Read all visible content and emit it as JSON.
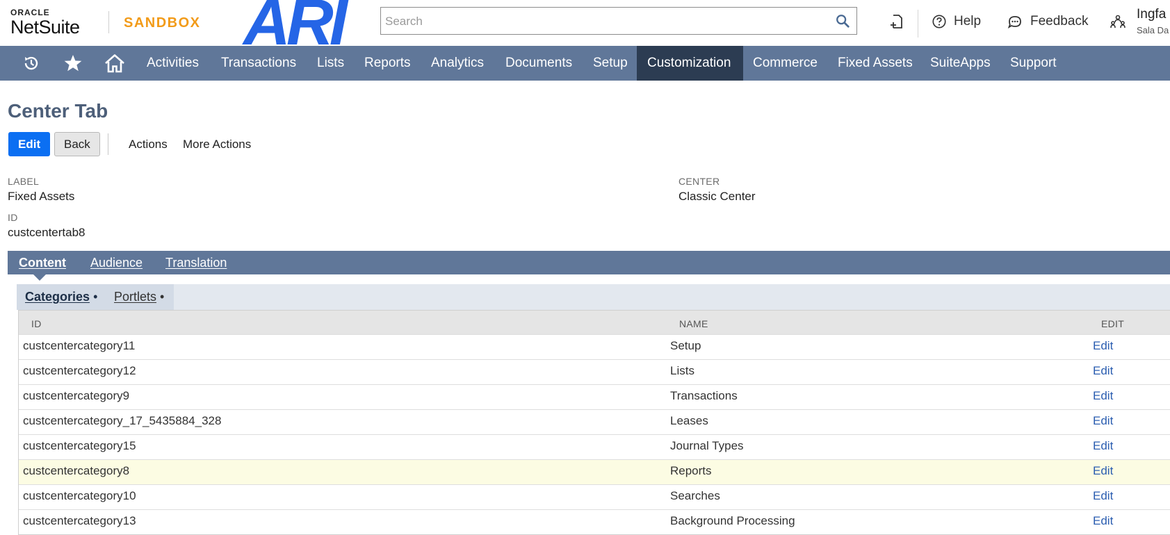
{
  "header": {
    "logo_oracle": "ORACLE",
    "logo_netsuite": "NetSuite",
    "environment": "SANDBOX",
    "company_logo": "ARI",
    "search_placeholder": "Search",
    "help_label": "Help",
    "feedback_label": "Feedback",
    "user_name": "Ingfa",
    "user_role": "Sala Da"
  },
  "icons": {
    "search": "search-icon",
    "new_record": "new-record-icon",
    "help": "help-icon",
    "feedback": "feedback-icon",
    "user_roles": "user-roles-icon",
    "recent": "recent-records-icon",
    "shortcuts": "shortcuts-star-icon",
    "home": "home-icon"
  },
  "nav": {
    "items": [
      "Activities",
      "Transactions",
      "Lists",
      "Reports",
      "Analytics",
      "Documents",
      "Setup",
      "Customization",
      "Commerce",
      "Fixed Assets",
      "SuiteApps",
      "Support"
    ],
    "active": "Customization"
  },
  "page": {
    "title": "Center Tab",
    "edit_button": "Edit",
    "back_button": "Back",
    "actions_label": "Actions",
    "more_actions_label": "More Actions"
  },
  "fields": {
    "label_caption": "LABEL",
    "label_value": "Fixed Assets",
    "center_caption": "CENTER",
    "center_value": "Classic Center",
    "id_caption": "ID",
    "id_value": "custcentertab8"
  },
  "tabs": [
    "Content",
    "Audience",
    "Translation"
  ],
  "active_tab": "Content",
  "subtabs": [
    "Categories",
    "Portlets"
  ],
  "active_subtab": "Categories",
  "subtab_marker": "•",
  "table": {
    "columns": [
      "ID",
      "NAME",
      "EDIT"
    ],
    "rows": [
      {
        "id": "custcentercategory11",
        "name": "Setup",
        "edit": "Edit"
      },
      {
        "id": "custcentercategory12",
        "name": "Lists",
        "edit": "Edit"
      },
      {
        "id": "custcentercategory9",
        "name": "Transactions",
        "edit": "Edit"
      },
      {
        "id": "custcentercategory_17_5435884_328",
        "name": "Leases",
        "edit": "Edit"
      },
      {
        "id": "custcentercategory15",
        "name": "Journal Types",
        "edit": "Edit"
      },
      {
        "id": "custcentercategory8",
        "name": "Reports",
        "edit": "Edit"
      },
      {
        "id": "custcentercategory10",
        "name": "Searches",
        "edit": "Edit"
      },
      {
        "id": "custcentercategory13",
        "name": "Background Processing",
        "edit": "Edit"
      }
    ],
    "highlighted_row": 5
  },
  "colors": {
    "nav_bg": "#607799",
    "nav_active_bg": "#2c3c52",
    "primary_button": "#0b6ff2",
    "sandbox_orange": "#f29b19",
    "company_logo_blue": "#2565e6",
    "title_color": "#4d5f79",
    "link_color": "#2a5db0",
    "row_highlight": "#fcfce3"
  }
}
